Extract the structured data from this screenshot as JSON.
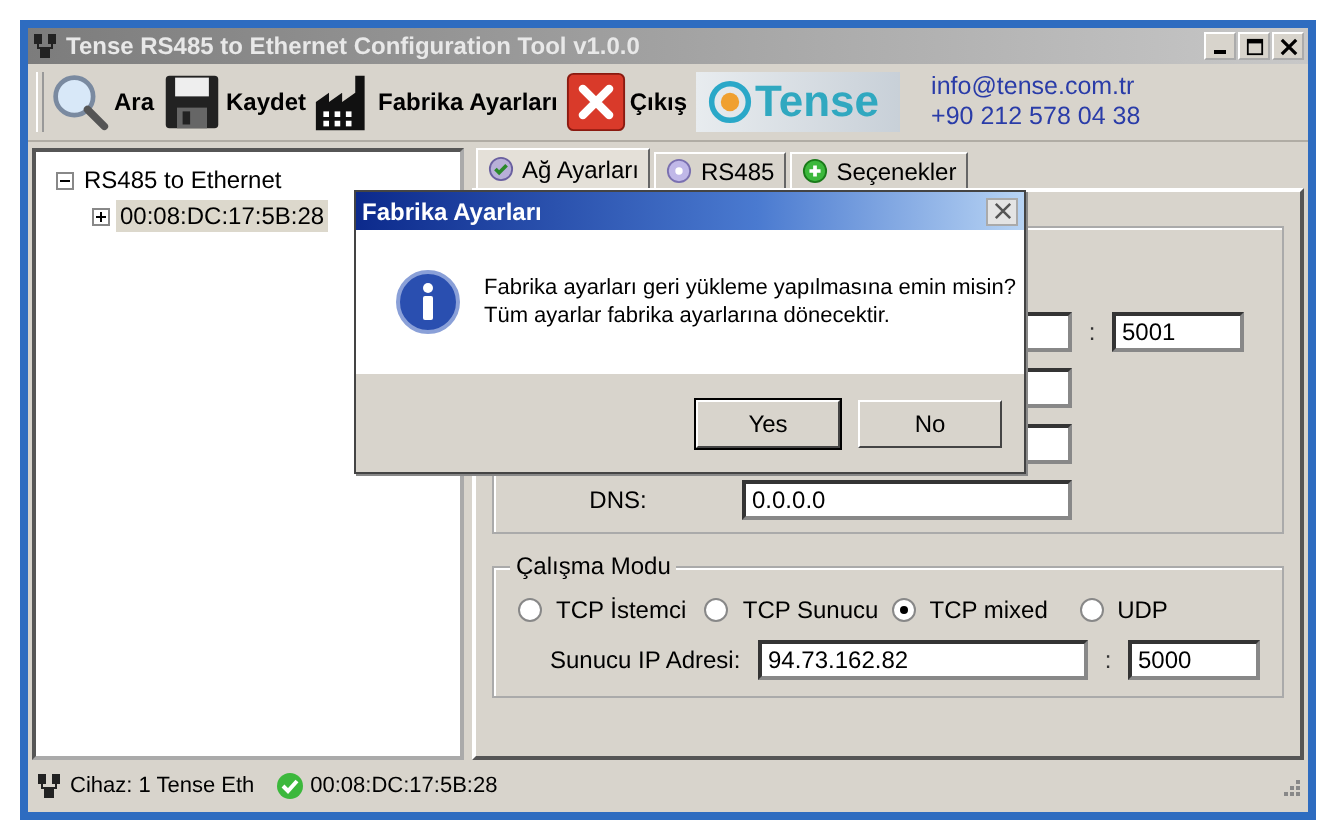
{
  "window": {
    "title": "Tense RS485 to Ethernet Configuration Tool v1.0.0",
    "active": false
  },
  "toolbar": [
    {
      "label": "Ara",
      "kind": "search"
    },
    {
      "label": "Kaydet",
      "kind": "save"
    },
    {
      "label": "Fabrika Ayarları",
      "kind": "factory"
    },
    {
      "label": "Çıkış",
      "kind": "exit"
    }
  ],
  "logo": {
    "text": "Tense"
  },
  "contact": [
    "info@tense.com.tr",
    "+90 212 578 04 38"
  ],
  "tree": [
    {
      "label": "RS485 to Ethernet",
      "expanded": true,
      "selected": false,
      "children": [
        {
          "label": "00:08:DC:17:5B:28",
          "expanded": false,
          "selected": true
        }
      ]
    }
  ],
  "tabs": [
    {
      "label": "Ağ Ayarları",
      "selected": true,
      "kind": "check"
    },
    {
      "label": "RS485",
      "selected": false,
      "kind": "disc"
    },
    {
      "label": "Seçenekler",
      "selected": false,
      "kind": "plus"
    }
  ],
  "network": {
    "rows": [
      {
        "separator": ":",
        "port": "5001"
      },
      {},
      {},
      {
        "label": "DNS:",
        "value": "0.0.0.0"
      }
    ]
  },
  "mode": {
    "title": "Çalışma Modu",
    "options": [
      {
        "label": "TCP İstemci",
        "selected": false
      },
      {
        "label": "TCP Sunucu",
        "selected": false
      },
      {
        "label": "TCP mixed",
        "selected": true
      },
      {
        "label": "UDP",
        "selected": false
      }
    ],
    "server_label": "Sunucu IP Adresi:",
    "server_ip": "94.73.162.82",
    "separator": ":",
    "port": "5000"
  },
  "status": {
    "device": "Cihaz: 1 Tense Eth",
    "connected": true,
    "mac": "00:08:DC:17:5B:28"
  },
  "dialog": {
    "title": "Fabrika Ayarları",
    "lines": [
      "Fabrika ayarları geri yükleme yapılmasına emin misin?",
      "Tüm ayarlar fabrika ayarlarına dönecektir."
    ],
    "buttons": [
      {
        "label": "Yes",
        "default": true
      },
      {
        "label": "No",
        "default": false
      }
    ]
  }
}
